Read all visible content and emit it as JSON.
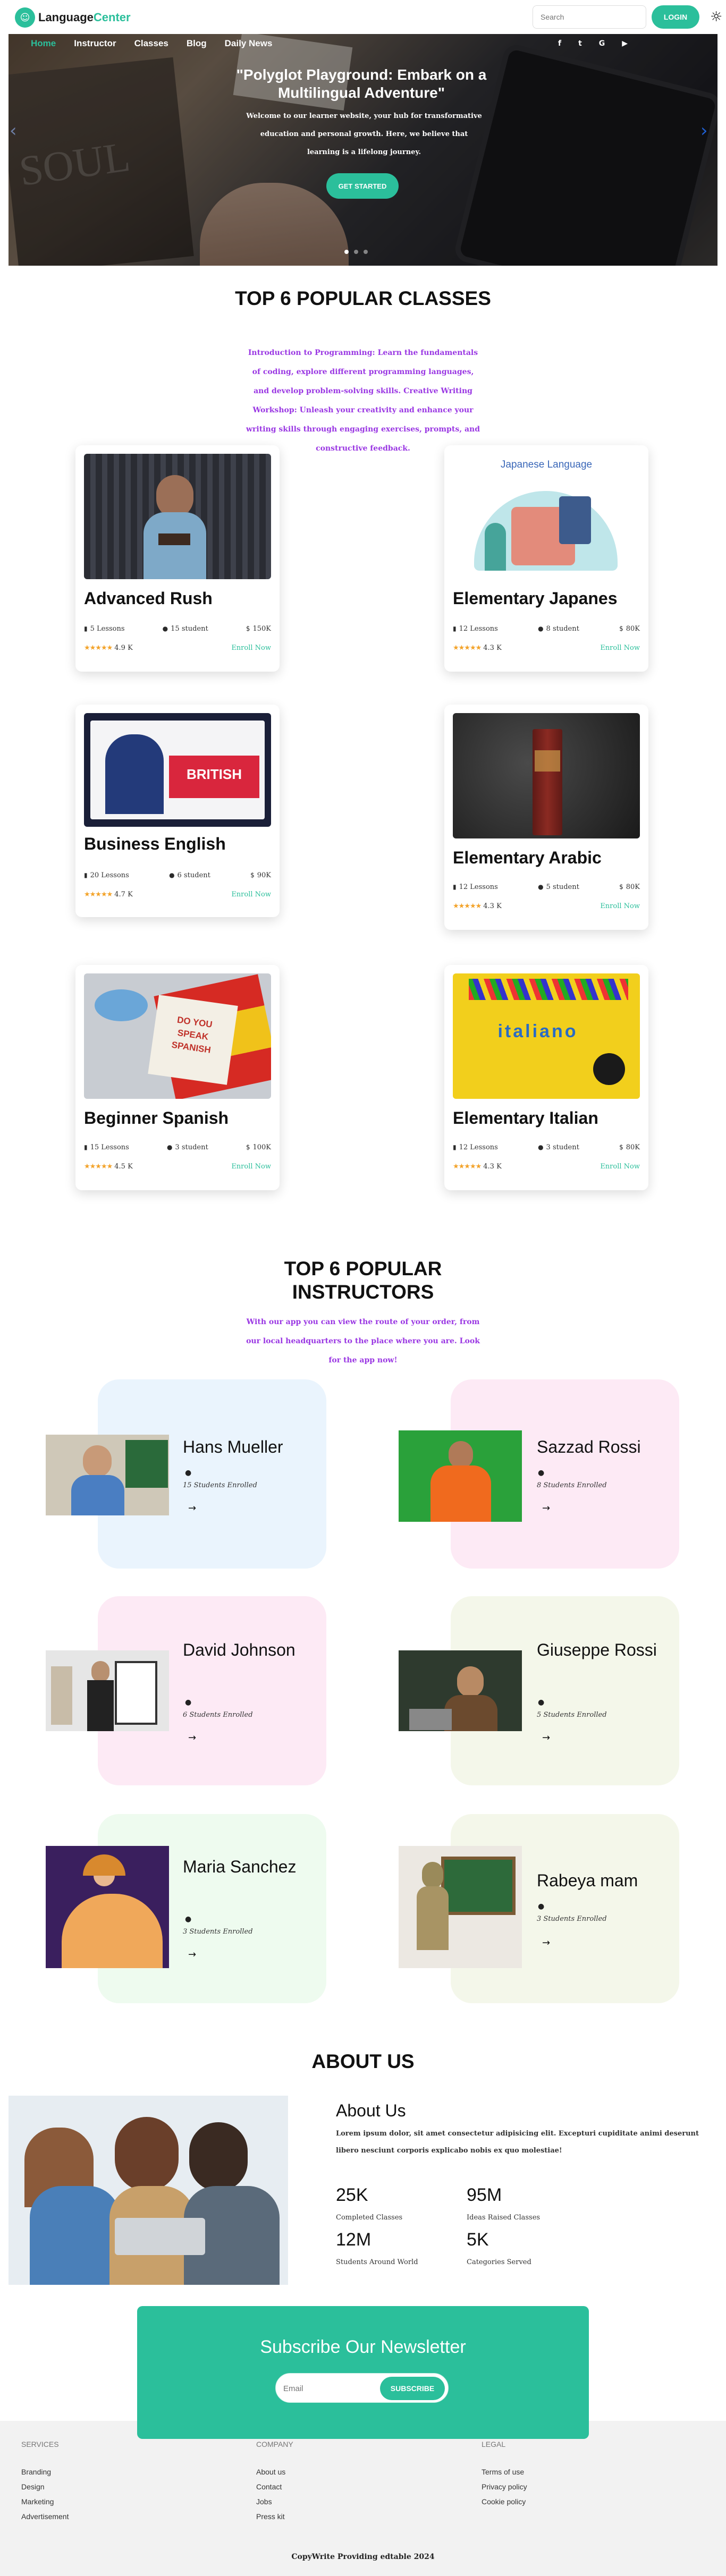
{
  "header": {
    "logo_left": "Language",
    "logo_right": "Center",
    "search_placeholder": "Search",
    "login_label": "LOGIN"
  },
  "nav": [
    "Home",
    "Instructor",
    "Classes",
    "Blog",
    "Daily News"
  ],
  "socials": [
    "f",
    "t",
    "G",
    "▶"
  ],
  "hero": {
    "book_text": "SOUL",
    "title": "\"Polyglot Playground: Embark on a Multilingual Adventure\"",
    "subtitle": "Welcome to our learner website, your hub for transformative education and personal growth. Here, we believe that learning is a lifelong journey.",
    "button": "GET STARTED"
  },
  "classes_section": {
    "title": "TOP 6 POPULAR CLASSES",
    "description": "Introduction to Programming: Learn the fundamentals of coding, explore different programming languages, and develop problem-solving skills. Creative Writing Workshop: Unleash your creativity and enhance your writing skills through engaging exercises, prompts, and constructive feedback.",
    "enroll_label": "Enroll Now",
    "cards": [
      {
        "title": "Advanced Rush",
        "lessons": "5 Lessons",
        "students": "15 student",
        "price": "150K",
        "rating": "4.9 K"
      },
      {
        "title": "Elementary Japanes",
        "lessons": "12 Lessons",
        "students": "8 student",
        "price": "80K",
        "rating": "4.3 K",
        "image_text": "Japanese Language"
      },
      {
        "title": "Business English",
        "lessons": "20 Lessons",
        "students": "6 student",
        "price": "90K",
        "rating": "4.7 K",
        "image_text": "BRITISH"
      },
      {
        "title": "Elementary Arabic",
        "lessons": "12 Lessons",
        "students": "5 student",
        "price": "80K",
        "rating": "4.3 K"
      },
      {
        "title": "Beginner Spanish",
        "lessons": "15 Lessons",
        "students": "3 student",
        "price": "100K",
        "rating": "4.5 K",
        "image_text": "DO YOU SPEAK SPANISH"
      },
      {
        "title": "Elementary Italian",
        "lessons": "12 Lessons",
        "students": "3 student",
        "price": "80K",
        "rating": "4.3 K",
        "image_text": "italiano"
      }
    ]
  },
  "instructors_section": {
    "title": "TOP 6 POPULAR INSTRUCTORS",
    "description": "With our app you can view the route of your order, from our local headquarters to the place where you are. Look for the app now!",
    "items": [
      {
        "name": "Hans Mueller",
        "enrolled": "15 Students Enrolled"
      },
      {
        "name": "Sazzad Rossi",
        "enrolled": "8 Students Enrolled"
      },
      {
        "name": "David Johnson",
        "enrolled": "6 Students Enrolled"
      },
      {
        "name": "Giuseppe Rossi",
        "enrolled": "5 Students Enrolled"
      },
      {
        "name": "Maria Sanchez",
        "enrolled": "3 Students Enrolled"
      },
      {
        "name": "Rabeya mam",
        "enrolled": "3 Students Enrolled"
      }
    ]
  },
  "about": {
    "section_title": "ABOUT US",
    "heading": "About Us",
    "text": "Lorem ipsum dolor, sit amet consectetur adipisicing elit. Excepturi cupiditate animi deserunt libero nesciunt corporis explicabo nobis ex quo molestiae!",
    "stats": [
      {
        "value": "25K",
        "label": "Completed Classes"
      },
      {
        "value": "95M",
        "label": "Ideas Raised Classes"
      },
      {
        "value": "12M",
        "label": "Students Around World"
      },
      {
        "value": "5K",
        "label": "Categories Served"
      }
    ]
  },
  "newsletter": {
    "title": "Subscribe Our Newsletter",
    "placeholder": "Email",
    "button": "SUBSCRIBE"
  },
  "footer": {
    "columns": [
      {
        "heading": "SERVICES",
        "links": [
          "Branding",
          "Design",
          "Marketing",
          "Advertisement"
        ]
      },
      {
        "heading": "COMPANY",
        "links": [
          "About us",
          "Contact",
          "Jobs",
          "Press kit"
        ]
      },
      {
        "heading": "LEGAL",
        "links": [
          "Terms of use",
          "Privacy policy",
          "Cookie policy"
        ]
      }
    ],
    "copyright": "CopyWrite Providing edtable 2024"
  },
  "colors": {
    "accent": "#2bbf9b",
    "purple_text": "#9a37e3",
    "star": "#f3a32a",
    "arrow_blue": "#1f5fd1"
  }
}
